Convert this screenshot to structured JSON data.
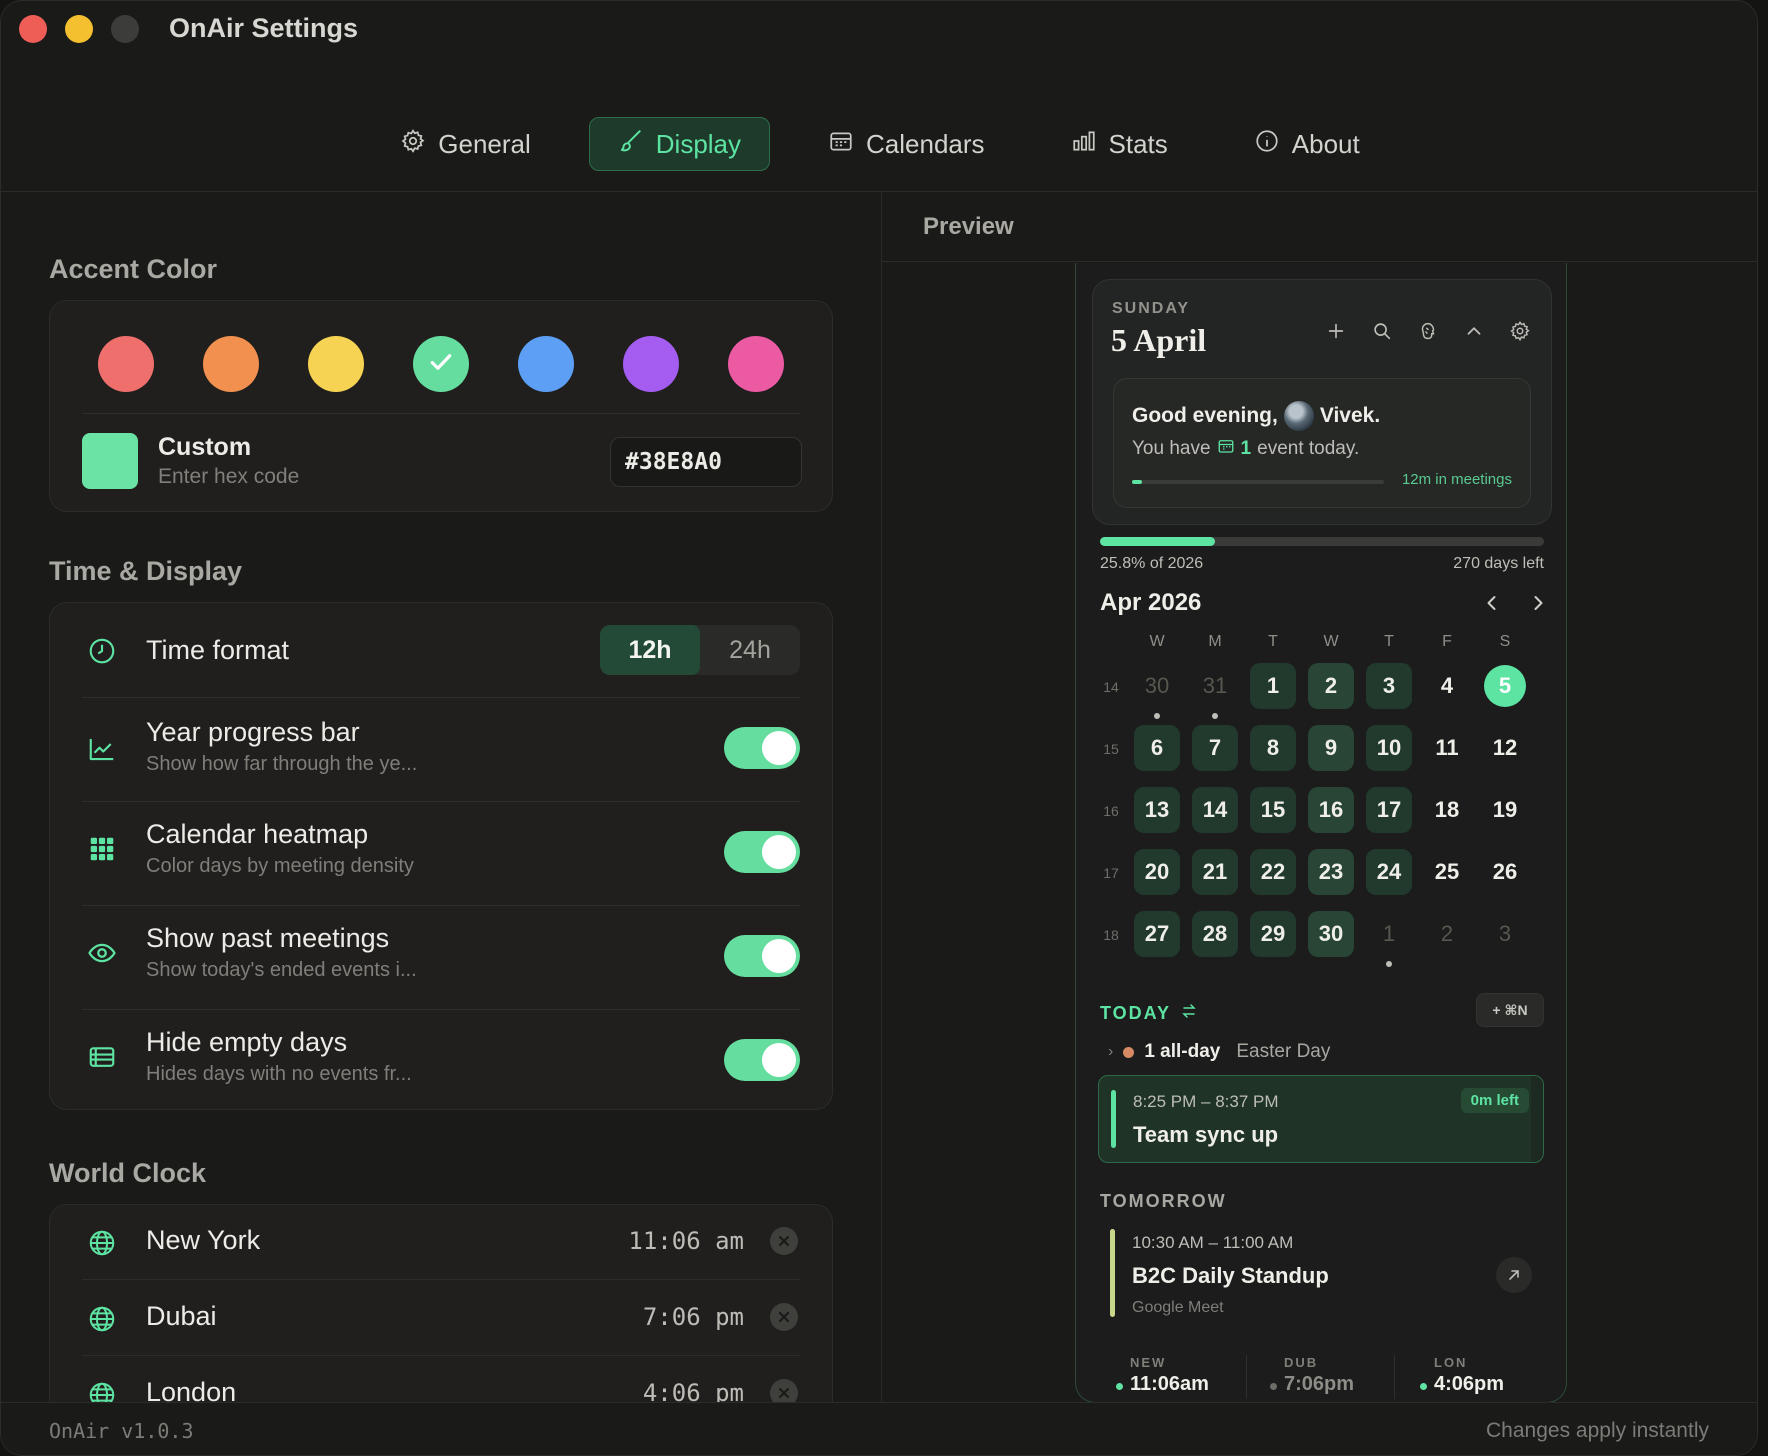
{
  "window": {
    "title": "OnAir Settings"
  },
  "tabs": [
    {
      "label": "General",
      "icon": "gear-icon"
    },
    {
      "label": "Display",
      "icon": "brush-icon",
      "active": true
    },
    {
      "label": "Calendars",
      "icon": "calendar-icon"
    },
    {
      "label": "Stats",
      "icon": "bar-chart-icon"
    },
    {
      "label": "About",
      "icon": "info-icon"
    }
  ],
  "accent": {
    "title": "Accent Color",
    "swatches": [
      "#ef6f6c",
      "#f2904f",
      "#f7d354",
      "#64dd9e",
      "#5c9ff5",
      "#a45df0",
      "#eb5aa3"
    ],
    "selected_index": 3,
    "custom_label": "Custom",
    "custom_sub": "Enter hex code",
    "hex_value": "#38E8A0",
    "custom_color": "#6ae3a4"
  },
  "time_display": {
    "title": "Time & Display",
    "time_format": {
      "label": "Time format",
      "options": [
        "12h",
        "24h"
      ],
      "selected": "12h"
    },
    "year_progress": {
      "label": "Year progress bar",
      "sub": "Show how far through the ye...",
      "on": true
    },
    "heatmap": {
      "label": "Calendar heatmap",
      "sub": "Color days by meeting density",
      "on": true
    },
    "past_meetings": {
      "label": "Show past meetings",
      "sub": "Show today's ended events i...",
      "on": true
    },
    "hide_empty": {
      "label": "Hide empty days",
      "sub": "Hides days with no events fr...",
      "on": true
    }
  },
  "world_clock": {
    "title": "World Clock",
    "items": [
      {
        "city": "New York",
        "time": "11:06 am"
      },
      {
        "city": "Dubai",
        "time": "7:06 pm"
      },
      {
        "city": "London",
        "time": "4:06 pm"
      }
    ]
  },
  "preview": {
    "title": "Preview",
    "day_of_week": "SUNDAY",
    "date": "5 April",
    "greeting_prefix": "Good evening,",
    "greeting_name": "Vivek.",
    "events_prefix": "You have",
    "events_count": "1",
    "events_suffix": "event today.",
    "meetings_label": "12m in meetings",
    "meetings_fraction": 0.04,
    "year_fraction": 0.258,
    "year_label": "25.8% of 2026",
    "days_left": "270 days left",
    "month_label": "Apr 2026",
    "weekday_headers": [
      "W",
      "M",
      "T",
      "W",
      "T",
      "F",
      "S"
    ],
    "weeks": [
      {
        "num": "14",
        "days": [
          "30",
          "31",
          "1",
          "2",
          "3",
          "4",
          "5"
        ]
      },
      {
        "num": "15",
        "days": [
          "6",
          "7",
          "8",
          "9",
          "10",
          "11",
          "12"
        ]
      },
      {
        "num": "16",
        "days": [
          "13",
          "14",
          "15",
          "16",
          "17",
          "18",
          "19"
        ]
      },
      {
        "num": "17",
        "days": [
          "20",
          "21",
          "22",
          "23",
          "24",
          "25",
          "26"
        ]
      },
      {
        "num": "18",
        "days": [
          "27",
          "28",
          "29",
          "30",
          "1",
          "2",
          "3"
        ]
      }
    ],
    "today_label": "TODAY",
    "add_label": "+ ⌘N",
    "allday_count": "1 all-day",
    "allday_name": "Easter Day",
    "current_event": {
      "time": "8:25 PM – 8:37 PM",
      "title": "Team sync up",
      "badge": "0m left"
    },
    "tomorrow_label": "TOMORROW",
    "next_event": {
      "time": "10:30 AM – 11:00 AM",
      "title": "B2C Daily Standup",
      "sub": "Google Meet"
    },
    "clocks": [
      {
        "code": "NEW",
        "time": "11:06am",
        "color": "#5de3a2"
      },
      {
        "code": "DUB",
        "time": "7:06pm",
        "color": "#6d6c67"
      },
      {
        "code": "LON",
        "time": "4:06pm",
        "color": "#5de3a2"
      }
    ]
  },
  "footer": {
    "version": "OnAir v1.0.3",
    "note": "Changes apply instantly"
  }
}
